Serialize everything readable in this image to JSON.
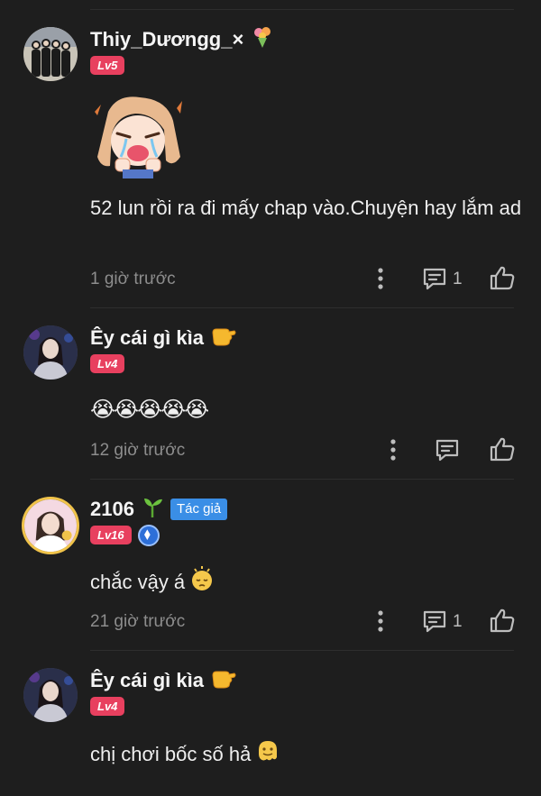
{
  "comments": [
    {
      "username": "Thiy_Dươngg_×",
      "level": "Lv5",
      "text": "52 lun rồi ra đi mấy chap vào.Chuyện hay lắm ad",
      "time": "1 giờ trước",
      "reply_count": "1",
      "username_emoji": "bouquet-icon",
      "has_sticker": true
    },
    {
      "username": "Êy cái gì kìa",
      "level": "Lv4",
      "text": "😭😭😭😭😭",
      "time": "12 giờ trước",
      "reply_count": "",
      "username_emoji": "pointing-hand-icon"
    },
    {
      "username": "2106",
      "level": "Lv16",
      "author_tag": "Tác giả",
      "text": "chắc vậy á",
      "time": "21 giờ trước",
      "reply_count": "1",
      "username_emoji": "seedling-icon",
      "text_emoji": "sleepy-face-icon"
    },
    {
      "username": "Êy cái gì kìa",
      "level": "Lv4",
      "text": "chị chơi bốc số hả",
      "username_emoji": "pointing-hand-icon",
      "text_emoji": "melting-face-icon"
    }
  ],
  "colors": {
    "background": "#1e1e1e",
    "level_badge": "#e8405f",
    "author_tag": "#3a8ee6",
    "time_text": "#8d8d8d"
  }
}
